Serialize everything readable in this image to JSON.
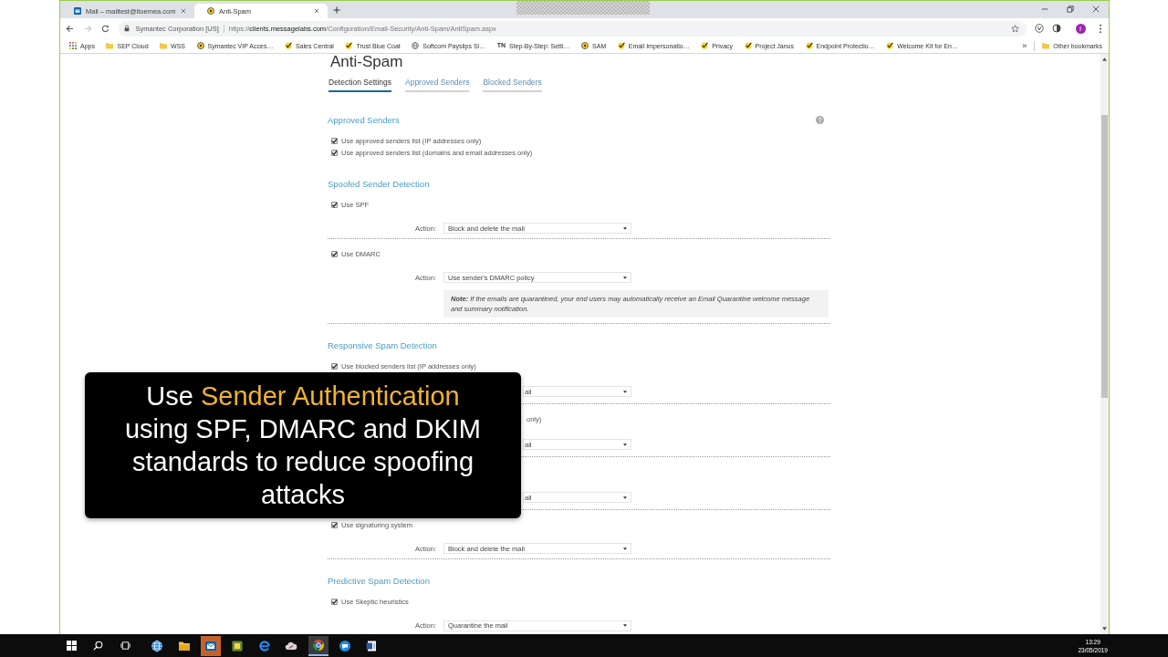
{
  "browser": {
    "tabs": [
      {
        "kind": "mail",
        "title": "Mail – mailtest@itoemea.com",
        "selected": false
      },
      {
        "kind": "badge",
        "title": "Anti-Spam",
        "selected": true
      }
    ],
    "address": {
      "identity": "Symantec Corporation [US]",
      "scheme": "https://",
      "host": "clients.messagelabs.com",
      "path": "/Configuration/Email-Security/Anti-Spam/AntiSpam.aspx"
    },
    "profile_initial": "I",
    "bookmarks": [
      {
        "kind": "apps",
        "label": "Apps"
      },
      {
        "kind": "folder",
        "label": "SEP Cloud"
      },
      {
        "kind": "folder",
        "label": "WSS"
      },
      {
        "kind": "badge",
        "label": "Symantec VIP Acces…"
      },
      {
        "kind": "check",
        "label": "Sales Central"
      },
      {
        "kind": "check",
        "label": "Trust Blue Coat"
      },
      {
        "kind": "globe",
        "label": "Softcom Payslips Si…"
      },
      {
        "kind": "initials",
        "initials": "TN",
        "label": "Step-By-Step: Setti…"
      },
      {
        "kind": "badge",
        "label": "SAM"
      },
      {
        "kind": "check",
        "label": "Email Impersonatio…"
      },
      {
        "kind": "check",
        "label": "Privacy"
      },
      {
        "kind": "check",
        "label": "Project Janus"
      },
      {
        "kind": "check",
        "label": "Endpoint Protectio…"
      },
      {
        "kind": "check",
        "label": "Welcome Kit for En…"
      }
    ],
    "bookmarks_overflow": "»",
    "other_bookmarks": "Other bookmarks"
  },
  "page": {
    "title": "Anti-Spam",
    "tabs": [
      {
        "label": "Detection Settings",
        "selected": true
      },
      {
        "label": "Approved Senders",
        "selected": false
      },
      {
        "label": "Blocked Senders",
        "selected": false
      }
    ],
    "sections": [
      {
        "title": "Approved Senders",
        "help": true,
        "options": [
          {
            "kind": "full",
            "label": "Use approved senders list (IP addresses only)",
            "checked": true
          },
          {
            "kind": "full",
            "label": "Use approved senders list (domains and email addresses only)",
            "checked": true
          }
        ]
      },
      {
        "title": "Spoofed Sender Detection",
        "options": [
          {
            "kind": "full",
            "label": "Use SPF",
            "checked": true,
            "action": {
              "kind": "full",
              "label": "Action:",
              "value": "Block and delete the mail"
            }
          },
          {
            "kind": "full",
            "label": "Use DMARC",
            "checked": true,
            "action": {
              "kind": "full",
              "label": "Action:",
              "value": "Use sender's DMARC policy"
            },
            "note": "**Note:** If the emails are quarantined, your end users may automatically receive an Email Quarantine welcome message and summary notification."
          }
        ]
      },
      {
        "title": "Responsive Spam Detection",
        "options": [
          {
            "kind": "full",
            "label": "Use blocked senders list (IP addresses only)",
            "checked": true,
            "action": {
              "kind": "clipped",
              "value": "ail"
            }
          },
          {
            "kind": "clipped",
            "label": "only)",
            "action": {
              "kind": "clipped",
              "value": "ail"
            }
          },
          {
            "kind": "hidden",
            "action": {
              "kind": "clipped",
              "value": "ail"
            }
          },
          {
            "kind": "full",
            "label": "Use signaturing system",
            "checked": true,
            "action": {
              "kind": "full",
              "label": "Action:",
              "value": "Block and delete the mail"
            }
          }
        ]
      },
      {
        "title": "Predictive Spam Detection",
        "options": [
          {
            "kind": "full",
            "label": "Use Skeptic heuristics",
            "checked": true,
            "action": {
              "kind": "full",
              "label": "Action:",
              "value": "Quarantine the mail"
            }
          }
        ]
      }
    ]
  },
  "caption": {
    "segments": [
      {
        "text": "Use ",
        "highlight": false
      },
      {
        "text": "Sender Authentication",
        "highlight": true
      },
      {
        "text": " using SPF, DMARC and DKIM standards to reduce spoofing attacks",
        "highlight": false
      }
    ]
  },
  "taskbar": {
    "apps": [
      {
        "kind": "globe",
        "active": false,
        "attention": false
      },
      {
        "kind": "folder",
        "active": false,
        "attention": false
      },
      {
        "kind": "mail",
        "active": false,
        "attention": true
      },
      {
        "kind": "tile",
        "active": false,
        "attention": false
      },
      {
        "kind": "e_logo",
        "active": false,
        "attention": false
      },
      {
        "kind": "cloud",
        "active": false,
        "attention": false
      },
      {
        "kind": "browser",
        "active": true,
        "attention": false
      },
      {
        "kind": "chat",
        "active": false,
        "attention": false
      },
      {
        "kind": "document",
        "active": false,
        "attention": false
      }
    ],
    "time": "13:29",
    "date": "23/05/2019"
  }
}
